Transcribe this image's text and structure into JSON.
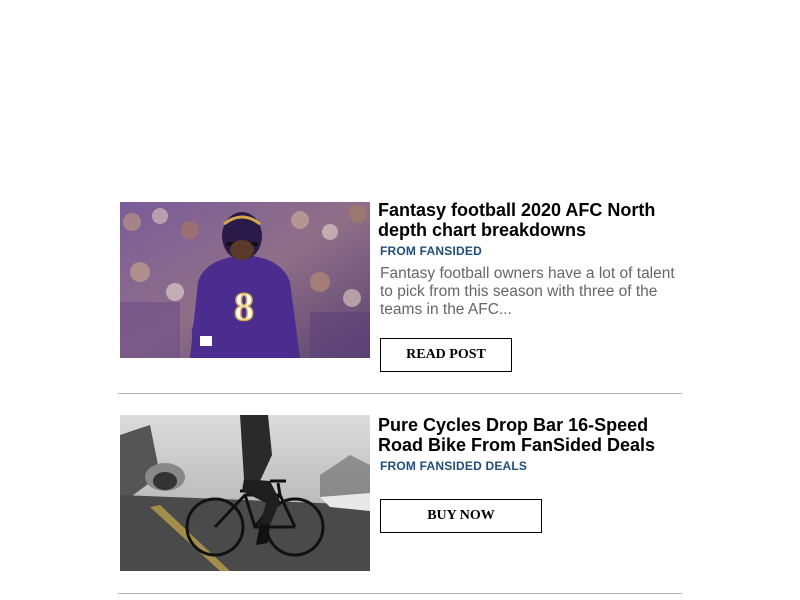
{
  "articles": [
    {
      "title": "Fantasy football 2020 AFC North depth chart breakdowns",
      "source": "FROM FANSIDED",
      "excerpt": "Fantasy football owners have a lot of talent to pick from this season with three of the teams in the AFC...",
      "cta": "READ POST",
      "image": "football-player-purple-jersey-8"
    },
    {
      "title": "Pure Cycles Drop Bar 16-Speed Road Bike From FanSided Deals",
      "source": "FROM FANSIDED DEALS",
      "cta": "BUY NOW",
      "image": "cyclist-on-road-bike-grayscale"
    }
  ],
  "colors": {
    "source_text": "#1f4e79",
    "excerpt_text": "#666666",
    "divider": "#b3b3b3",
    "jersey": "#4b2d8f"
  }
}
